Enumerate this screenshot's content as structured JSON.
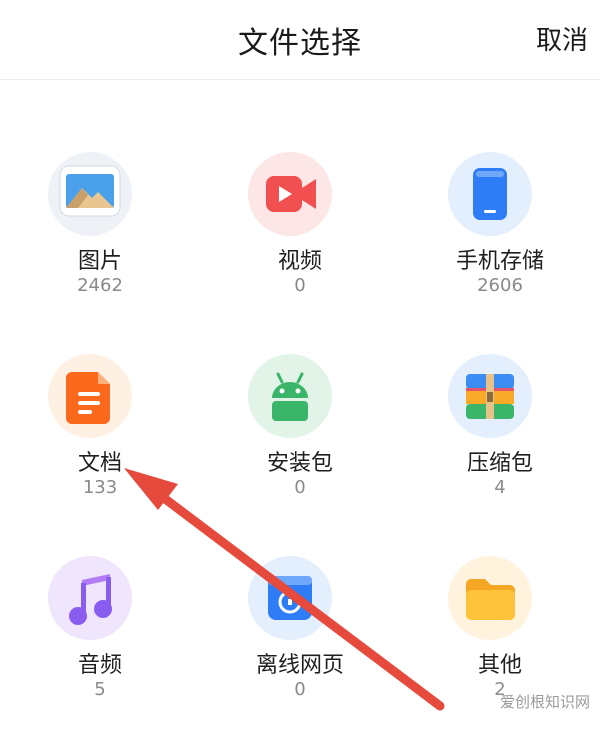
{
  "header": {
    "title": "文件选择",
    "cancel_label": "取消"
  },
  "categories": [
    {
      "label": "图片",
      "count": "2462",
      "icon": "image-icon"
    },
    {
      "label": "视频",
      "count": "0",
      "icon": "video-icon"
    },
    {
      "label": "手机存储",
      "count": "2606",
      "icon": "phone-storage-icon"
    },
    {
      "label": "文档",
      "count": "133",
      "icon": "document-icon"
    },
    {
      "label": "安装包",
      "count": "0",
      "icon": "android-package-icon"
    },
    {
      "label": "压缩包",
      "count": "4",
      "icon": "archive-icon"
    },
    {
      "label": "音频",
      "count": "5",
      "icon": "music-icon"
    },
    {
      "label": "离线网页",
      "count": "0",
      "icon": "offline-webpage-icon"
    },
    {
      "label": "其他",
      "count": "2",
      "icon": "folder-icon"
    }
  ],
  "watermark": "爱创根知识网",
  "colors": {
    "arrow": "#e64a3c",
    "video": "#f25050",
    "phone": "#2f7df6",
    "document": "#fb6a1c",
    "android": "#3bb56a",
    "music": "#8a5cf0",
    "webpage": "#2f7df6",
    "folder": "#ffb020"
  }
}
